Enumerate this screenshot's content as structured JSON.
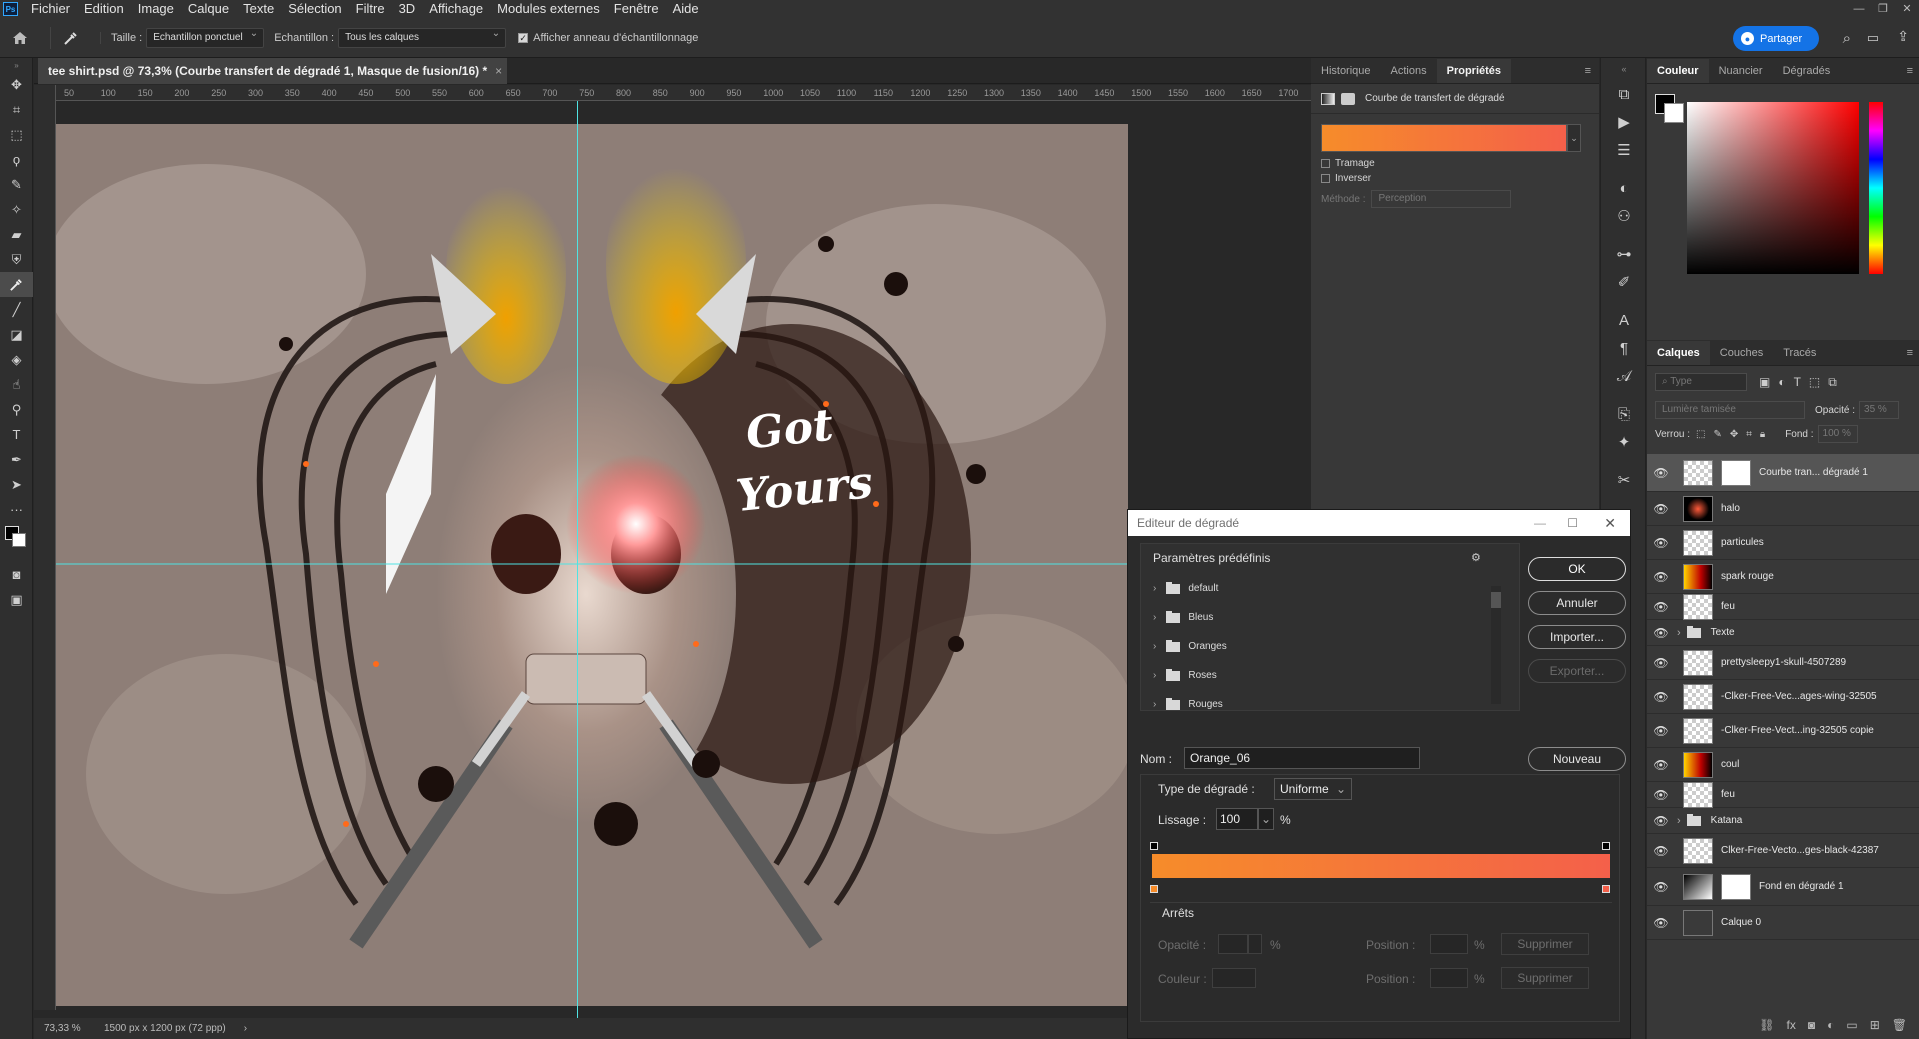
{
  "menubar": {
    "logo": "Ps",
    "items": [
      "Fichier",
      "Edition",
      "Image",
      "Calque",
      "Texte",
      "Sélection",
      "Filtre",
      "3D",
      "Affichage",
      "Modules externes",
      "Fenêtre",
      "Aide"
    ]
  },
  "options": {
    "size_label": "Taille :",
    "size_value": "Echantillon ponctuel",
    "sample_label": "Echantillon :",
    "sample_value": "Tous les calques",
    "ring_label": "Afficher anneau d'échantillonnage",
    "share_label": "Partager"
  },
  "document": {
    "tab_title": "tee shirt.psd @ 73,3% (Courbe transfert de dégradé 1, Masque de fusion/16) *",
    "ruler_ticks": [
      "50",
      "100",
      "150",
      "200",
      "250",
      "300",
      "350",
      "400",
      "450",
      "500",
      "550",
      "600",
      "650",
      "700",
      "750",
      "800",
      "850",
      "900",
      "950",
      "1000",
      "1050",
      "1100",
      "1150",
      "1200",
      "1250",
      "1300",
      "1350",
      "1400",
      "1450",
      "1500",
      "1550",
      "1600",
      "1650",
      "1700"
    ],
    "zoom": "73,33 %",
    "doc_size": "1500 px x 1200 px (72 ppp)",
    "art_text_1": "Got",
    "art_text_2": "Yours"
  },
  "properties": {
    "tabs": [
      "Historique",
      "Actions",
      "Propriétés"
    ],
    "title": "Courbe de transfert de dégradé",
    "dither": "Tramage",
    "reverse": "Inverser",
    "method_label": "Méthode :",
    "method_value": "Perception",
    "gradient_from": "#f68c2a",
    "gradient_to": "#f4604a"
  },
  "color_panel": {
    "tabs": [
      "Couleur",
      "Nuancier",
      "Dégradés"
    ]
  },
  "layers_panel": {
    "tabs": [
      "Calques",
      "Couches",
      "Tracés"
    ],
    "search_placeholder": "Type",
    "blend_mode": "Lumière tamisée",
    "opacity_label": "Opacité :",
    "opacity_value": "35 %",
    "lock_label": "Verrou :",
    "fill_label": "Fond :",
    "fill_value": "100 %",
    "layers": [
      {
        "name": "Courbe tran... dégradé 1",
        "selected": true
      },
      {
        "name": "halo"
      },
      {
        "name": "particules"
      },
      {
        "name": "spark rouge"
      },
      {
        "name": "feu"
      },
      {
        "name": "Texte"
      },
      {
        "name": "prettysleepy1-skull-4507289"
      },
      {
        "name": "-Clker-Free-Vec...ages-wing-32505"
      },
      {
        "name": "-Clker-Free-Vect...ing-32505 copie"
      },
      {
        "name": "coul"
      },
      {
        "name": "feu"
      },
      {
        "name": "Katana"
      },
      {
        "name": "Clker-Free-Vecto...ges-black-42387"
      },
      {
        "name": "Fond en dégradé 1"
      },
      {
        "name": "Calque 0"
      }
    ]
  },
  "gradient_editor": {
    "title": "Editeur de dégradé",
    "presets_label": "Paramètres prédéfinis",
    "presets": [
      "default",
      "Bleus",
      "Oranges",
      "Roses",
      "Rouges"
    ],
    "ok": "OK",
    "cancel": "Annuler",
    "import": "Importer...",
    "export": "Exporter...",
    "name_label": "Nom :",
    "name_value": "Orange_06",
    "new": "Nouveau",
    "type_label": "Type de dégradé :",
    "type_value": "Uniforme",
    "smooth_label": "Lissage :",
    "smooth_value": "100",
    "percent": "%",
    "stops_label": "Arrêts",
    "opacity_label": "Opacité :",
    "color_label": "Couleur :",
    "position_label": "Position :",
    "delete": "Supprimer",
    "color_start": "#f68c2a",
    "color_end": "#f4604a"
  }
}
